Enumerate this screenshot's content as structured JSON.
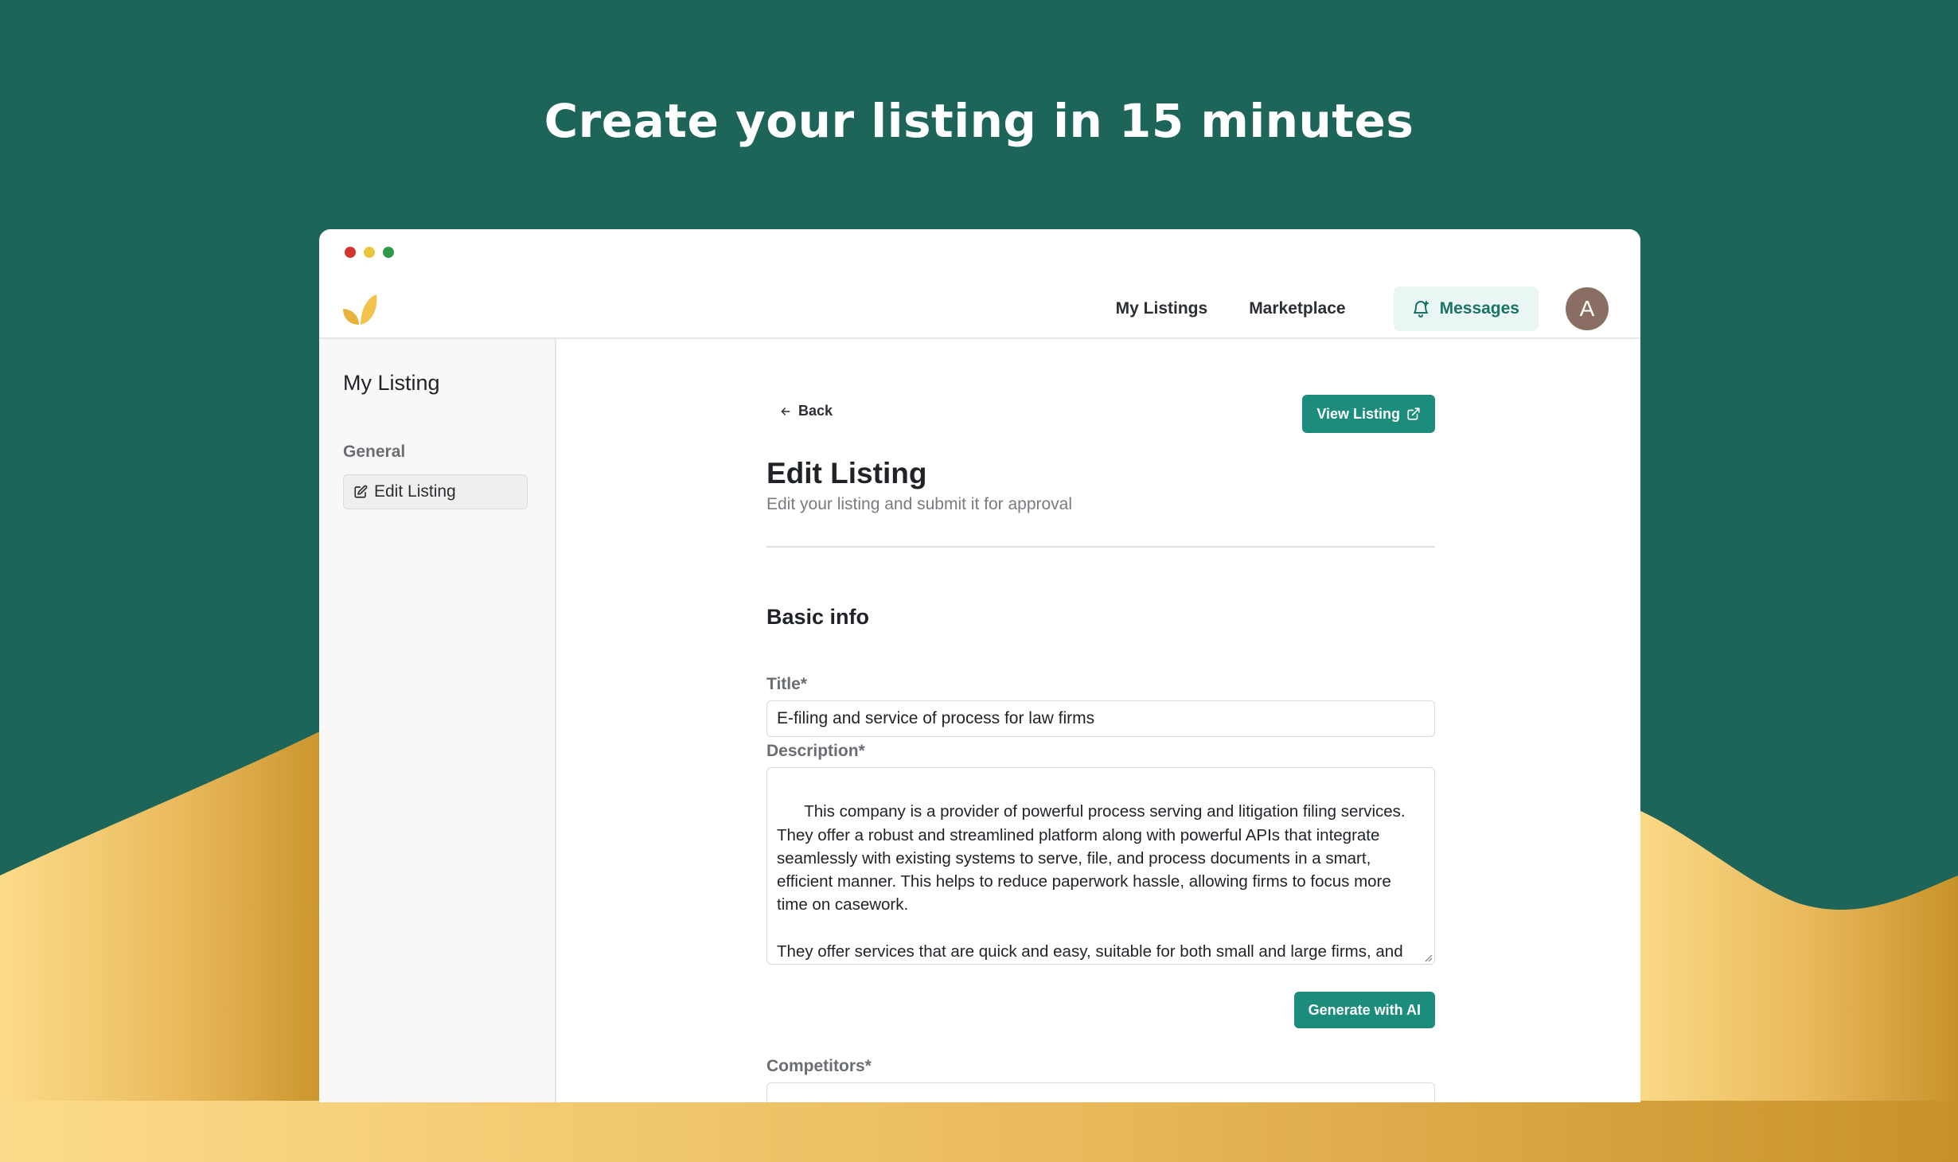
{
  "hero": {
    "headline": "Create your listing in 15 minutes"
  },
  "window": {
    "traffic_light_colors": [
      "#d0342c",
      "#e8c53a",
      "#2e9a48"
    ]
  },
  "topnav": {
    "logo_icon": "leaf-logo-icon",
    "links": [
      {
        "label": "My Listings"
      },
      {
        "label": "Marketplace"
      },
      {
        "label": "Messages",
        "icon": "bell-icon",
        "active": true
      }
    ],
    "avatar_initial": "A"
  },
  "sidebar": {
    "title": "My Listing",
    "section": "General",
    "items": [
      {
        "label": "Edit Listing",
        "icon": "edit-icon",
        "active": true
      }
    ]
  },
  "main": {
    "back_label": "Back",
    "view_listing_label": "View Listing",
    "title": "Edit Listing",
    "subtitle": "Edit your listing and submit it for approval",
    "section_title": "Basic info",
    "fields": {
      "title": {
        "label": "Title*",
        "value": "E-filing and service of process for law firms"
      },
      "description": {
        "label": "Description*",
        "value": "This company is a provider of powerful process serving and litigation filing services. They offer a robust and streamlined platform along with powerful APIs that integrate seamlessly with existing systems to serve, file, and process documents in a smart, efficient manner. This helps to reduce paperwork hassle, allowing firms to focus more time on casework.\n\nThey offer services that are quick and easy, suitable for both small and large firms, and accessible from anywhere, any time. Their system provides automation for"
      },
      "competitors": {
        "label": "Competitors*",
        "value": ""
      }
    },
    "generate_ai_label": "Generate with AI"
  },
  "colors": {
    "background_teal": "#1c6558",
    "accent": "#1c8c7c",
    "gold_light": "#fcdc8a",
    "gold_dark": "#c8922a"
  }
}
